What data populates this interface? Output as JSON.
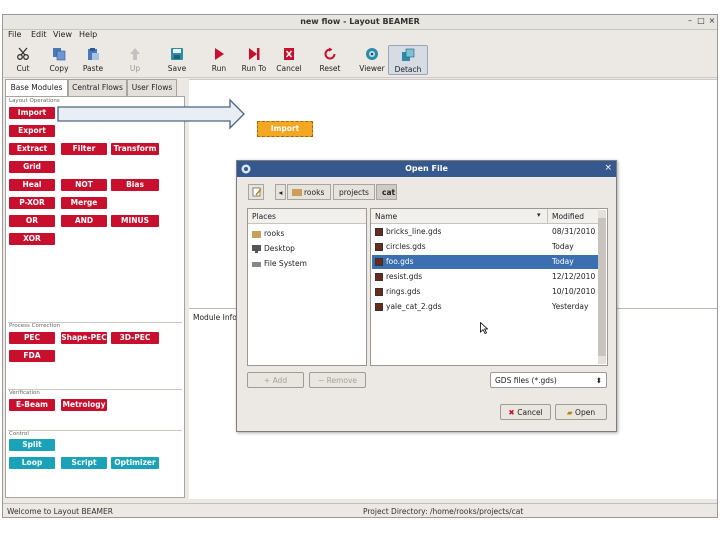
{
  "window": {
    "title": "new flow - Layout BEAMER"
  },
  "menu": [
    {
      "label": "File"
    },
    {
      "label": "Edit"
    },
    {
      "label": "View"
    },
    {
      "label": "Help"
    }
  ],
  "toolbar": [
    {
      "label": "Cut",
      "icon": "scissors-icon"
    },
    {
      "label": "Copy",
      "icon": "copy-icon"
    },
    {
      "label": "Paste",
      "icon": "paste-icon"
    },
    {
      "label": "Up",
      "icon": "arrow-up-icon",
      "disabled": true
    },
    {
      "label": "Save",
      "icon": "save-icon"
    },
    {
      "label": "Run",
      "icon": "run-icon"
    },
    {
      "label": "Run To",
      "icon": "run-to-icon"
    },
    {
      "label": "Cancel",
      "icon": "cancel-icon"
    },
    {
      "label": "Reset",
      "icon": "reset-icon"
    },
    {
      "label": "Viewer",
      "icon": "viewer-icon"
    },
    {
      "label": "Detach",
      "icon": "detach-icon",
      "active": true
    }
  ],
  "tabs": [
    {
      "label": "Base Modules",
      "selected": true
    },
    {
      "label": "Central Flows"
    },
    {
      "label": "User Flows"
    }
  ],
  "sections": {
    "layout": "Layout Operations",
    "process": "Process Correction",
    "verification": "Verification",
    "control": "Control"
  },
  "modules": {
    "layout": [
      "Import",
      "Export",
      "Extract",
      "Filter",
      "Transform",
      "Grid",
      "Heal",
      "NOT",
      "Bias",
      "P-XOR",
      "Merge",
      "OR",
      "AND",
      "MINUS",
      "XOR"
    ],
    "process": [
      "PEC",
      "Shape-PEC",
      "3D-PEC",
      "FDA"
    ],
    "verification": [
      "E-Beam",
      "Metrology"
    ],
    "control": [
      "Split",
      "Loop",
      "Script",
      "Optimizer"
    ]
  },
  "canvas": {
    "node_label": "Import"
  },
  "module_info": {
    "label": "Module Info"
  },
  "status": {
    "left": "Welcome to Layout BEAMER",
    "right": "Project Directory: /home/rooks/projects/cat"
  },
  "colors": {
    "module_red": "#c8102e",
    "module_teal": "#1aa3b8",
    "node_orange": "#f5a623",
    "selection_blue": "#3c6fb0",
    "dialog_title": "#35598e"
  },
  "dialog": {
    "title": "Open File",
    "crumbs": [
      {
        "label": "rooks"
      },
      {
        "label": "projects"
      },
      {
        "label": "cat",
        "selected": true
      }
    ],
    "places_header": "Places",
    "places": [
      {
        "label": "rooks",
        "icon": "home-folder-icon"
      },
      {
        "label": "Desktop",
        "icon": "desktop-icon"
      },
      {
        "label": "File System",
        "icon": "drive-icon"
      }
    ],
    "columns": {
      "name": "Name",
      "modified": "Modified"
    },
    "files": [
      {
        "name": "bricks_line.gds",
        "modified": "08/31/2010"
      },
      {
        "name": "circles.gds",
        "modified": "Today"
      },
      {
        "name": "foo.gds",
        "modified": "Today",
        "selected": true
      },
      {
        "name": "resist.gds",
        "modified": "12/12/2010"
      },
      {
        "name": "rings.gds",
        "modified": "10/10/2010"
      },
      {
        "name": "yale_cat_2.gds",
        "modified": "Yesterday"
      }
    ],
    "add_label": "Add",
    "remove_label": "Remove",
    "filter": "GDS files (*.gds)",
    "cancel_label": "Cancel",
    "open_label": "Open"
  }
}
